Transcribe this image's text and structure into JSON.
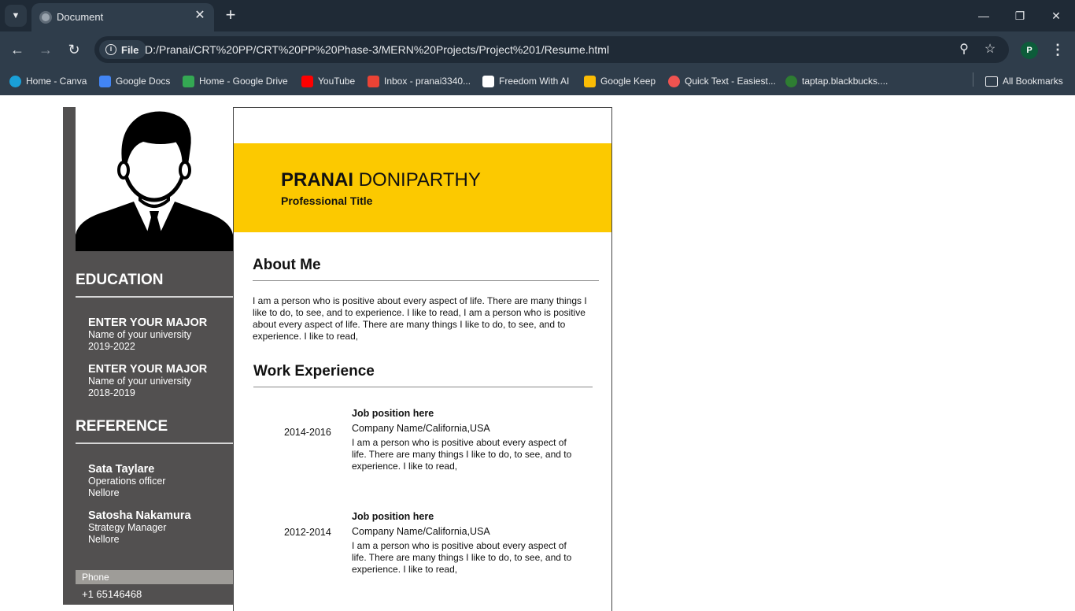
{
  "browser": {
    "tab_title": "Document",
    "file_label": "File",
    "url": "D:/Pranai/CRT%20PP/CRT%20PP%20Phase-3/MERN%20Projects/Project%201/Resume.html",
    "profile_initial": "P",
    "bookmarks": [
      {
        "label": "Home - Canva",
        "icon": "canva-icon",
        "color": "#1aa0d8"
      },
      {
        "label": "Google Docs",
        "icon": "docs-icon",
        "color": "#4285f4"
      },
      {
        "label": "Home - Google Drive",
        "icon": "drive-icon",
        "color": "#34a853"
      },
      {
        "label": "YouTube",
        "icon": "youtube-icon",
        "color": "#ff0000"
      },
      {
        "label": "Inbox - pranai3340...",
        "icon": "gmail-icon",
        "color": "#ea4335"
      },
      {
        "label": "Freedom With AI",
        "icon": "freedom-icon",
        "color": "#ffffff"
      },
      {
        "label": "Google Keep",
        "icon": "keep-icon",
        "color": "#fbbc04"
      },
      {
        "label": "Quick Text - Easiest...",
        "icon": "quicktext-icon",
        "color": "#ef5350"
      },
      {
        "label": "taptap.blackbucks....",
        "icon": "taptap-icon",
        "color": "#2e7d32"
      }
    ],
    "all_bookmarks": "All Bookmarks"
  },
  "resume": {
    "first_name": "PRANAI",
    "last_name": "DONIPARTHY",
    "title": "Professional Title",
    "education_heading": "EDUCATION",
    "education": [
      {
        "major": "ENTER YOUR MAJOR",
        "university": "Name of your university",
        "years": "2019-2022"
      },
      {
        "major": "ENTER YOUR MAJOR",
        "university": "Name of your university",
        "years": "2018-2019"
      }
    ],
    "reference_heading": "REFERENCE",
    "references": [
      {
        "name": "Sata Taylare",
        "role": "Operations officer",
        "place": "Nellore"
      },
      {
        "name": "Satosha Nakamura",
        "role": "Strategy Manager",
        "place": "Nellore"
      }
    ],
    "phone_label": "Phone",
    "phone": "+1 65146468",
    "about_heading": "About Me",
    "about_text": "I am a person who is positive about every aspect of life. There are many things I like to do, to see, and to experience. I like to read, I am a person who is positive about every aspect of life. There are many things I like to do, to see, and to experience. I like to read,",
    "work_heading": "Work Experience",
    "jobs": [
      {
        "years": "2014-2016",
        "position": "Job position here",
        "company": "Company Name/California,USA",
        "description": "I am a person who is positive about every aspect of life. There are many things I like to do, to see, and to experience. I like to read,"
      },
      {
        "years": "2012-2014",
        "position": "Job position here",
        "company": "Company Name/California,USA",
        "description": "I am a person who is positive about every aspect of life. There are many things I like to do, to see, and to experience. I like to read,"
      }
    ]
  }
}
